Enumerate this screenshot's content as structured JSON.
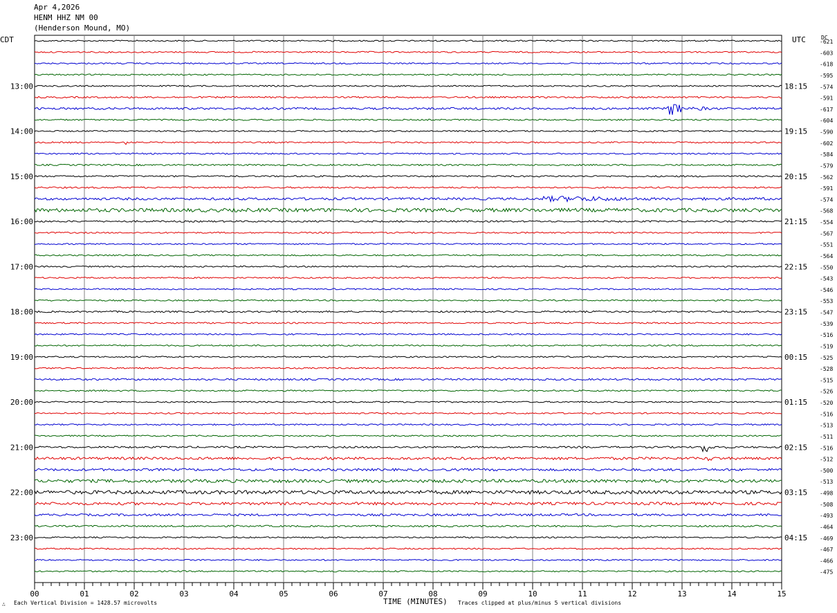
{
  "header": {
    "date": "Apr 4,2026",
    "station": "HENM HHZ NM 00",
    "location": "(Henderson Mound, MO)"
  },
  "left_zone_label": "CDT",
  "right_zone_label": "UTC",
  "dc_label": "DC",
  "footer": {
    "scale_note": "Each Vertical Division = 1428.57 microvolts",
    "clip_note": "Traces clipped at plus/minus 5 vertical divisions",
    "corner_mark": "∴"
  },
  "colors": {
    "trace_cycle": [
      "#000000",
      "#e00000",
      "#0000d0",
      "#006400"
    ],
    "grid": "#808080"
  },
  "chart_data": {
    "type": "line",
    "title": "",
    "xlabel": "TIME (MINUTES)",
    "ylabel": "",
    "xlim": [
      0,
      15
    ],
    "x_ticks": [
      "00",
      "01",
      "02",
      "03",
      "04",
      "05",
      "06",
      "07",
      "08",
      "09",
      "10",
      "11",
      "12",
      "13",
      "14",
      "15"
    ],
    "grid": true,
    "rows": 48,
    "left_hour_labels": [
      "13:00",
      "14:00",
      "15:00",
      "16:00",
      "17:00",
      "18:00",
      "19:00",
      "20:00",
      "21:00",
      "22:00",
      "23:00"
    ],
    "left_hour_start_row": 4,
    "right_hour_labels": [
      "18:15",
      "19:15",
      "20:15",
      "21:15",
      "22:15",
      "23:15",
      "00:15",
      "01:15",
      "02:15",
      "03:15",
      "04:15"
    ],
    "right_hour_start_row": 4,
    "dc_offsets": [
      -621,
      -603,
      -618,
      -595,
      -574,
      -591,
      -617,
      -604,
      -590,
      -602,
      -584,
      -579,
      -562,
      -591,
      -574,
      -568,
      -554,
      -567,
      -551,
      -564,
      -550,
      -543,
      -546,
      -553,
      -547,
      -539,
      -516,
      -519,
      -525,
      -528,
      -515,
      -526,
      -520,
      -516,
      -513,
      -511,
      -516,
      -512,
      -500,
      -513,
      -498,
      -508,
      -493,
      -464,
      -469,
      -467,
      -466,
      -475
    ],
    "base_noise": [
      1.0,
      1.0,
      1.0,
      1.0,
      1.0,
      1.2,
      1.5,
      1.0,
      1.0,
      1.0,
      1.0,
      1.1,
      1.1,
      1.1,
      1.7,
      2.6,
      1.2,
      1.0,
      1.0,
      1.0,
      1.0,
      1.0,
      1.0,
      1.0,
      1.2,
      1.0,
      1.0,
      1.0,
      1.0,
      1.0,
      1.3,
      1.0,
      1.0,
      1.0,
      1.0,
      1.0,
      1.3,
      1.9,
      1.7,
      2.3,
      2.6,
      2.0,
      1.6,
      1.2,
      1.0,
      1.0,
      1.0,
      1.0
    ],
    "events": [
      {
        "row": 6,
        "start_min": 12.7,
        "amplitude": 13,
        "duration_min": 0.9
      },
      {
        "row": 9,
        "start_min": 1.8,
        "amplitude": 3.5,
        "duration_min": 0.25
      },
      {
        "row": 14,
        "start_min": 10.2,
        "amplitude": 3.5,
        "duration_min": 4.8
      },
      {
        "row": 15,
        "start_min": 6.0,
        "amplitude": 4,
        "duration_min": 0.3
      },
      {
        "row": 36,
        "start_min": 13.4,
        "amplitude": 11,
        "duration_min": 0.5
      },
      {
        "row": 37,
        "start_min": 13.5,
        "amplitude": 4,
        "duration_min": 0.3
      }
    ]
  }
}
